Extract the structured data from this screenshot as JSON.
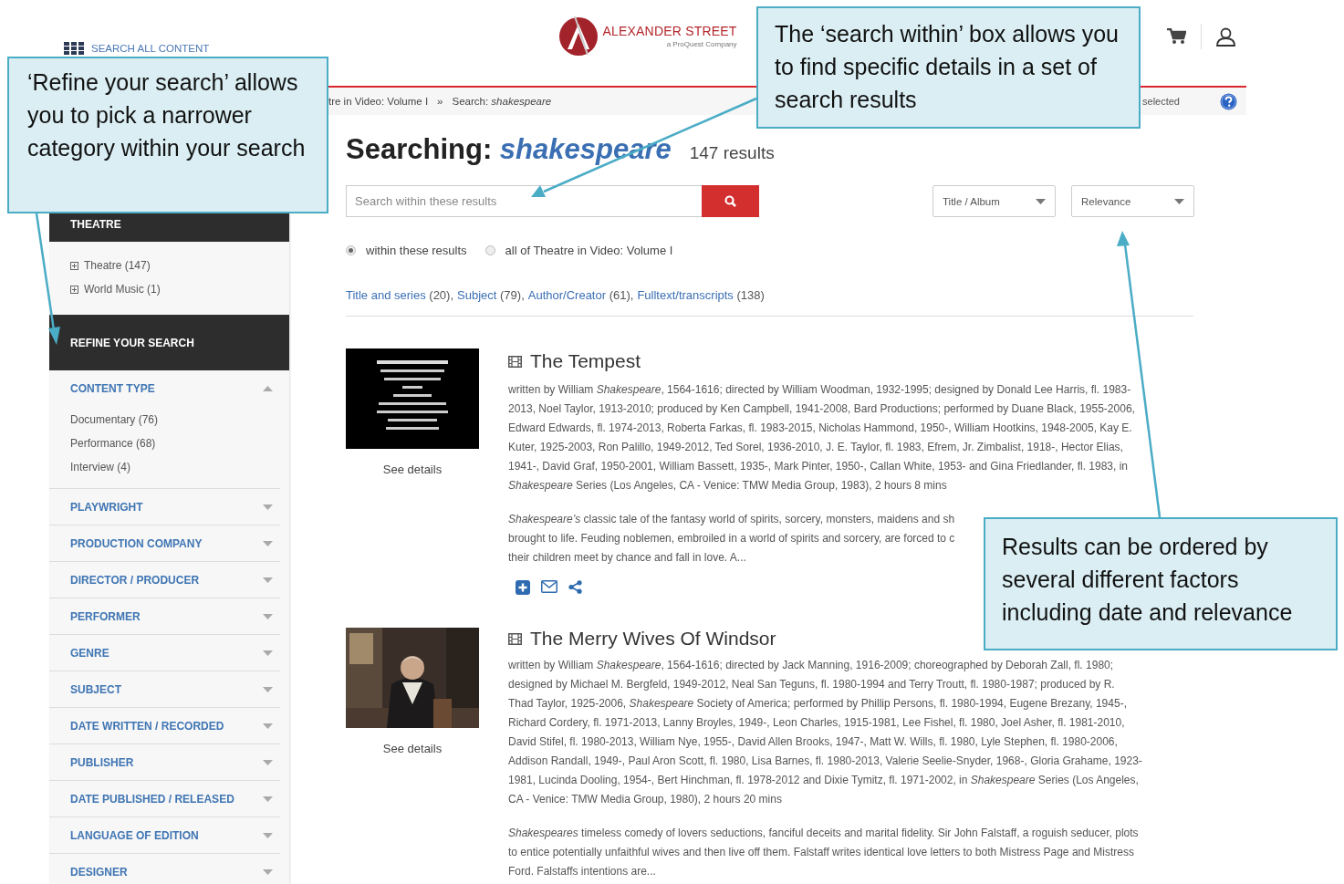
{
  "header": {
    "search_all": "SEARCH ALL CONTENT",
    "logo_name": "ALEXANDER STREET",
    "logo_tagline": "a ProQuest Company"
  },
  "breadcrumb": {
    "trail": "tre in Video: Volume I",
    "separator": "»",
    "current": "Search: *shakespeare*",
    "right_text": "selected"
  },
  "sidebar": {
    "collection_header": "THEATRE",
    "collections": [
      "Theatre (147)",
      "World Music (1)"
    ],
    "refine_header": "REFINE YOUR SEARCH",
    "facets": [
      {
        "label": "CONTENT TYPE",
        "expanded": true,
        "options": [
          "Documentary (76)",
          "Performance (68)",
          "Interview (4)"
        ]
      },
      {
        "label": "PLAYWRIGHT",
        "expanded": false
      },
      {
        "label": "PRODUCTION COMPANY",
        "expanded": false
      },
      {
        "label": "DIRECTOR / PRODUCER",
        "expanded": false
      },
      {
        "label": "PERFORMER",
        "expanded": false
      },
      {
        "label": "GENRE",
        "expanded": false
      },
      {
        "label": "SUBJECT",
        "expanded": false
      },
      {
        "label": "DATE WRITTEN / RECORDED",
        "expanded": false
      },
      {
        "label": "PUBLISHER",
        "expanded": false
      },
      {
        "label": "DATE PUBLISHED / RELEASED",
        "expanded": false
      },
      {
        "label": "LANGUAGE OF EDITION",
        "expanded": false
      },
      {
        "label": "DESIGNER",
        "expanded": false
      }
    ]
  },
  "search": {
    "heading": "Searching:",
    "term": "shakespeare",
    "count": "147 results",
    "placeholder": "Search within these results",
    "field_dropdown": "Title / Album",
    "sort_dropdown": "Relevance",
    "scope_options": [
      {
        "label": "within these results",
        "selected": true
      },
      {
        "label": "all of Theatre in Video: Volume I",
        "selected": false
      }
    ],
    "match_links": [
      {
        "label": "Title and series",
        "count": "(20),"
      },
      {
        "label": "Subject",
        "count": "(79),"
      },
      {
        "label": "Author/Creator",
        "count": "(61),"
      },
      {
        "label": "Fulltext/transcripts",
        "count": "(138)"
      }
    ]
  },
  "results": [
    {
      "title": "The Tempest",
      "see_details": "See details",
      "actions": [
        {
          "kind": "add"
        },
        {
          "kind": "email"
        },
        {
          "kind": "share"
        }
      ],
      "credits_lines": [
        "written by William *Shakespeare*, 1564-1616; directed by William Woodman, 1932-1995; designed by Donald Lee Harris, fl. 1983-",
        "2013, Noel Taylor, 1913-2010; produced by Ken Campbell, 1941-2008, Bard Productions; performed by Duane Black, 1955-2006,",
        "Edward Edwards, fl. 1974-2013, Roberta Farkas, fl. 1983-2015, Nicholas Hammond, 1950-, William Hootkins, 1948-2005, Kay E.",
        "Kuter, 1925-2003, Ron Palillo, 1949-2012, Ted Sorel, 1936-2010, J. E. Taylor, fl. 1983, Efrem, Jr. Zimbalist, 1918-, Hector Elias,",
        "1941-, David Graf, 1950-2001, William Bassett, 1935-, Mark Pinter, 1950-, Callan White, 1953- and Gina Friedlander, fl. 1983, in",
        "*Shakespeare* Series (Los Angeles, CA - Venice: TMW Media Group, 1983), 2 hours 8 mins"
      ],
      "description_lines": [
        "*Shakespeare’s* classic tale of the fantasy world of spirits, sorcery, monsters, maidens and sh",
        "brought to life. Feuding noblemen, embroiled in a world of spirits and sorcery, are forced to c",
        "their children meet by chance and fall in love. A..."
      ]
    },
    {
      "title": "The Merry Wives Of Windsor",
      "see_details": "See details",
      "credits_lines": [
        "written by William *Shakespeare*, 1564-1616; directed by Jack Manning, 1916-2009; choreographed by Deborah Zall, fl. 1980;",
        "designed by Michael M. Bergfeld, 1949-2012, Neal San Teguns, fl. 1980-1994 and Terry Troutt, fl. 1980-1987; produced by R.",
        "Thad Taylor, 1925-2006, *Shakespeare* Society of America; performed by Phillip Persons, fl. 1980-1994, Eugene Brezany, 1945-,",
        "Richard Cordery, fl. 1971-2013, Lanny Broyles, 1949-, Leon Charles, 1915-1981, Lee Fishel, fl. 1980, Joel Asher, fl. 1981-2010,",
        "David Stifel, fl. 1980-2013, William Nye, 1955-, David Allen Brooks, 1947-, Matt W. Wills, fl. 1980, Lyle Stephen, fl. 1980-2006,",
        "Addison Randall, 1949-, Paul Aron Scott, fl. 1980, Lisa Barnes, fl. 1980-2013, Valerie Seelie-Snyder, 1968-, Gloria Grahame, 1923-",
        "1981, Lucinda Dooling, 1954-, Bert Hinchman, fl. 1978-2012 and Dixie Tymitz, fl. 1971-2002, in *Shakespeare* Series (Los Angeles,",
        "CA - Venice: TMW Media Group, 1980), 2 hours 20 mins"
      ],
      "description_lines": [
        "*Shakespeares* timeless comedy of lovers seductions, fanciful deceits and marital fidelity. Sir John Falstaff, a roguish seducer, plots",
        "to entice potentially unfaithful wives and then live off them. Falstaff writes identical love letters to both Mistress Page and Mistress",
        "Ford. Falstaffs intentions are..."
      ]
    }
  ],
  "callouts": [
    {
      "text": "‘Refine your search’ allows you to pick a narrower category within your search"
    },
    {
      "text": "The ‘search within’ box allows you to find specific details in a set of search results"
    },
    {
      "text": "Results can be ordered by several different factors including date and relevance"
    }
  ]
}
